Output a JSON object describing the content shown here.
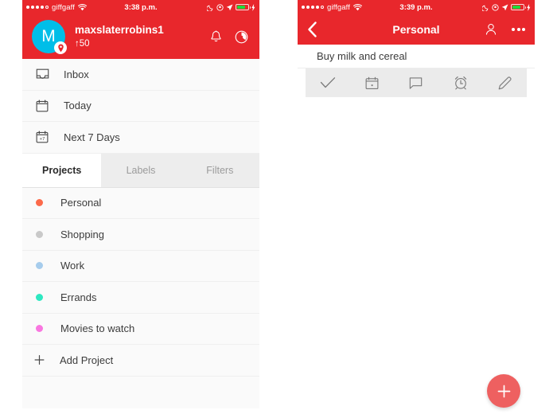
{
  "colors": {
    "brand_red": "#E8272C",
    "avatar_cyan": "#00BEE8",
    "fab_coral": "#EE6060",
    "battery_green": "#1DDC3C",
    "panel_bg": "#FAFAFA"
  },
  "left_panel": {
    "status_bar": {
      "carrier": "giffgaff",
      "time": "3:38 p.m.",
      "signal_icon": "signal-dots-icon",
      "wifi_icon": "wifi-icon",
      "moon_icon": "do-not-disturb-moon-icon",
      "rotation_lock_icon": "rotation-lock-icon",
      "location_icon": "location-arrow-icon",
      "battery_icon": "battery-icon",
      "charging_icon": "charging-bolt-icon"
    },
    "user_header": {
      "avatar_initial": "M",
      "avatar_badge_icon": "location-pin-badge-icon",
      "username": "maxslaterrobins1",
      "karma": "↑50",
      "bell_icon": "bell-icon",
      "gear_icon": "gear-icon"
    },
    "nav_items": [
      {
        "label": "Inbox",
        "icon": "inbox-tray-icon"
      },
      {
        "label": "Today",
        "icon": "calendar-icon"
      },
      {
        "label": "Next 7 Days",
        "icon": "calendar-next-7-days-icon"
      }
    ],
    "tabs": [
      {
        "label": "Projects",
        "active": true
      },
      {
        "label": "Labels",
        "active": false
      },
      {
        "label": "Filters",
        "active": false
      }
    ],
    "projects": [
      {
        "label": "Personal",
        "color": "#FC6A4A"
      },
      {
        "label": "Shopping",
        "color": "#C9C9C9"
      },
      {
        "label": "Work",
        "color": "#A6CCEC"
      },
      {
        "label": "Errands",
        "color": "#2EE8C1"
      },
      {
        "label": "Movies to watch",
        "color": "#F977E0"
      }
    ],
    "add_project": {
      "label": "Add Project",
      "icon": "plus-icon"
    }
  },
  "right_panel": {
    "status_bar": {
      "carrier": "giffgaff",
      "time": "3:39 p.m.",
      "signal_icon": "signal-dots-icon",
      "wifi_icon": "wifi-icon",
      "moon_icon": "do-not-disturb-moon-icon",
      "rotation_lock_icon": "rotation-lock-icon",
      "location_icon": "location-arrow-icon",
      "battery_icon": "battery-icon",
      "charging_icon": "charging-bolt-icon"
    },
    "nav_bar": {
      "back_icon": "back-chevron-icon",
      "title": "Personal",
      "share_icon": "add-person-icon",
      "more_icon": "more-options-dots-icon"
    },
    "task": {
      "title": "Buy milk and cereal"
    },
    "actions": [
      {
        "name": "complete",
        "icon": "checkmark-icon"
      },
      {
        "name": "schedule",
        "icon": "calendar-icon"
      },
      {
        "name": "comment",
        "icon": "comment-bubble-icon"
      },
      {
        "name": "reminder",
        "icon": "alarm-clock-icon"
      },
      {
        "name": "edit",
        "icon": "pencil-icon"
      }
    ],
    "fab": {
      "icon": "plus-icon"
    }
  }
}
